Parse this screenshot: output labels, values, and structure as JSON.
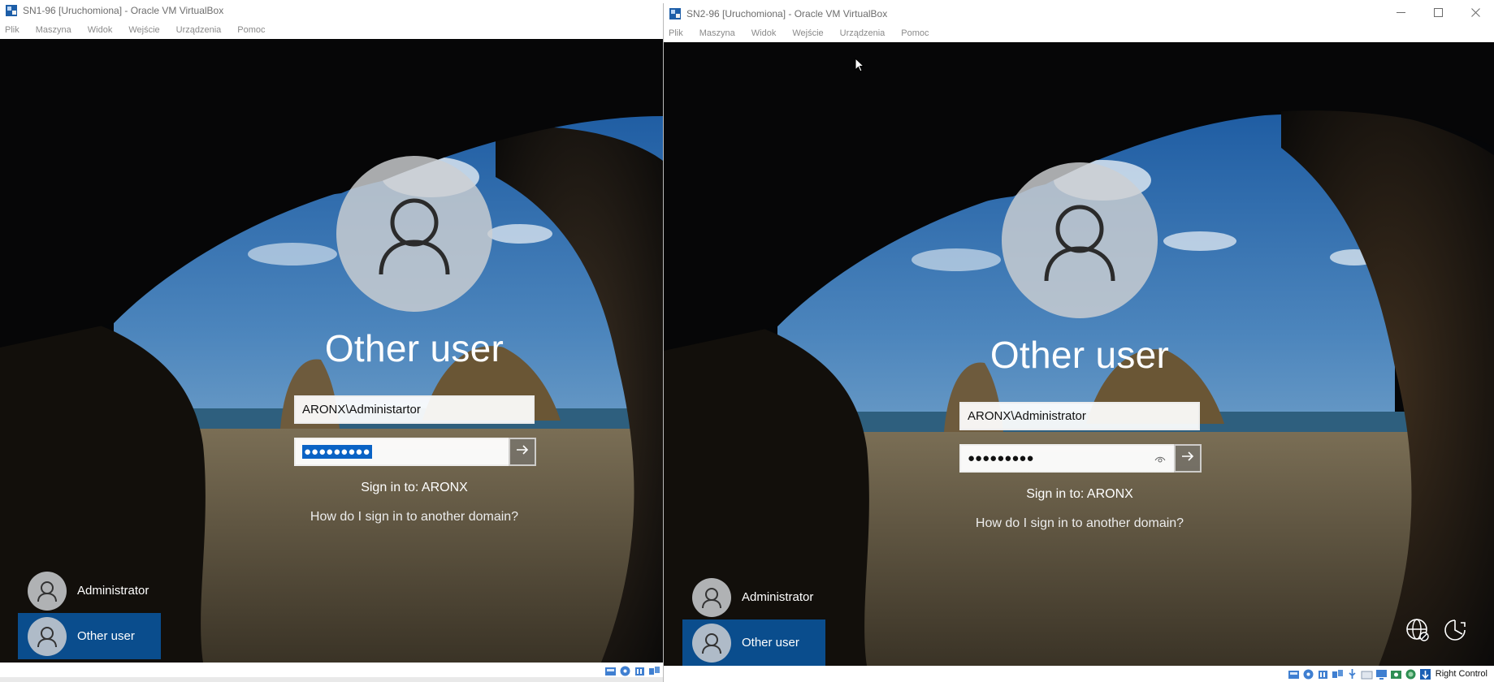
{
  "colors": {
    "tile_selected": "#0a4d8d",
    "password_selection": "#0a63c5",
    "screen_bg": "#050608"
  },
  "vm1": {
    "title": "SN1-96 [Uruchomiona] - Oracle VM VirtualBox",
    "menu": [
      "Plik",
      "Maszyna",
      "Widok",
      "Wejście",
      "Urządzenia",
      "Pomoc"
    ],
    "login": {
      "user_title": "Other user",
      "username_value": "ARONX\\Administartor",
      "password_masked": "●●●●●●●●●",
      "password_selected": true,
      "sign_in_to": "Sign in to: ARONX",
      "other_domain_link": "How do I sign in to another domain?"
    },
    "user_tiles": [
      {
        "label": "Administrator",
        "selected": false
      },
      {
        "label": "Other user",
        "selected": true
      }
    ]
  },
  "vm2": {
    "title": "SN2-96 [Uruchomiona] - Oracle VM VirtualBox",
    "menu": [
      "Plik",
      "Maszyna",
      "Widok",
      "Wejście",
      "Urządzenia",
      "Pomoc"
    ],
    "window_controls": [
      "minimize-icon",
      "maximize-icon",
      "close-icon"
    ],
    "login": {
      "user_title": "Other user",
      "username_value": "ARONX\\Administrator",
      "password_masked": "●●●●●●●●●",
      "password_selected": false,
      "sign_in_to": "Sign in to: ARONX",
      "other_domain_link": "How do I sign in to another domain?"
    },
    "user_tiles": [
      {
        "label": "Administrator",
        "selected": false
      },
      {
        "label": "Other user",
        "selected": true
      }
    ],
    "bottom_right_icons": [
      "network-icon",
      "ease-of-access-icon"
    ],
    "status_icons": [
      "hard-disk-icon",
      "optical-drive-icon",
      "audio-icon",
      "network-adapter-icon",
      "usb-icon",
      "shared-folders-icon",
      "display-icon",
      "video-capture-icon",
      "cpu-icon",
      "mouse-integration-icon"
    ],
    "host_key": "Right Control"
  }
}
